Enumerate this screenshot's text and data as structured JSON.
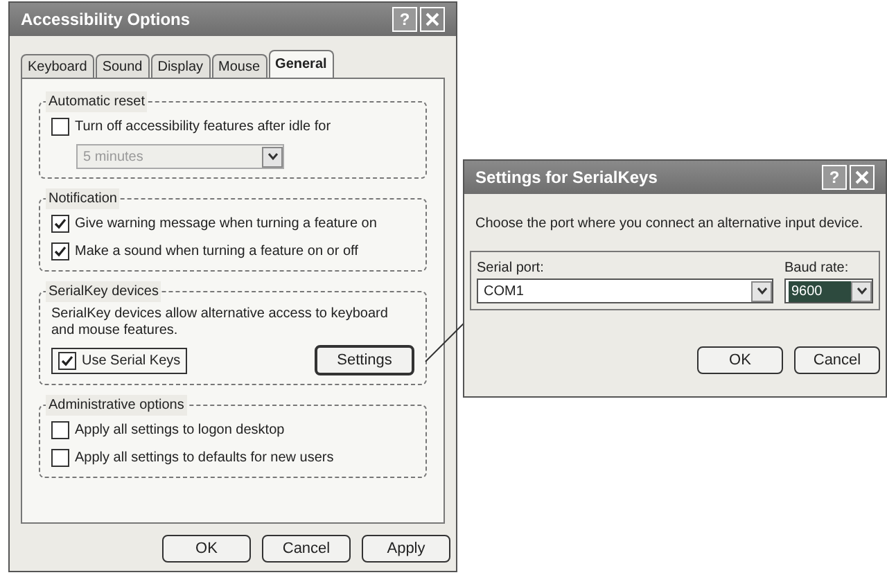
{
  "main_window": {
    "title": "Accessibility Options",
    "help_button": "?",
    "tabs": [
      {
        "label": "Keyboard",
        "selected": false
      },
      {
        "label": "Sound",
        "selected": false
      },
      {
        "label": "Display",
        "selected": false
      },
      {
        "label": "Mouse",
        "selected": false
      },
      {
        "label": "General",
        "selected": true
      }
    ],
    "automatic_reset": {
      "title": "Automatic reset",
      "checkbox": {
        "label": "Turn off accessibility features after idle for",
        "checked": false
      },
      "dropdown": {
        "value": "5 minutes",
        "disabled": true
      }
    },
    "notification": {
      "title": "Notification",
      "checkboxes": [
        {
          "label": "Give warning message when turning a feature on",
          "checked": true
        },
        {
          "label": "Make a sound when turning a feature on or off",
          "checked": true
        }
      ]
    },
    "serialkey_devices": {
      "title": "SerialKey devices",
      "description": "SerialKey devices allow alternative access to keyboard and mouse features.",
      "checkbox": {
        "label": "Use Serial Keys",
        "checked": true
      },
      "button": "Settings"
    },
    "administrative_options": {
      "title": "Administrative options",
      "checkboxes": [
        {
          "label": "Apply all settings to logon desktop",
          "checked": false
        },
        {
          "label": "Apply all settings to defaults for new users",
          "checked": false
        }
      ]
    },
    "buttons": [
      "OK",
      "Cancel",
      "Apply"
    ]
  },
  "settings_window": {
    "title": "Settings for SerialKeys",
    "help_button": "?",
    "instruction": "Choose the port where you connect an alternative input device.",
    "serial_port": {
      "label": "Serial port:",
      "value": "COM1"
    },
    "baud_rate": {
      "label": "Baud rate:",
      "value": "9600"
    },
    "buttons": [
      "OK",
      "Cancel"
    ]
  }
}
